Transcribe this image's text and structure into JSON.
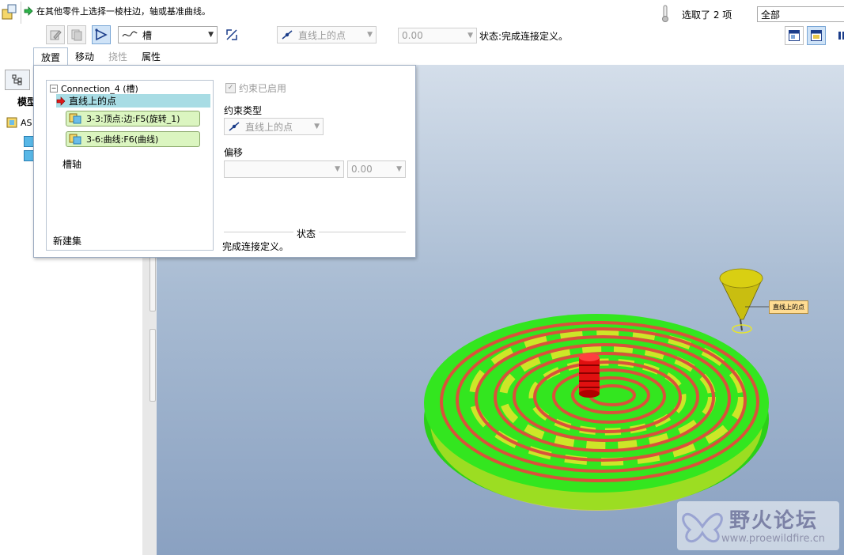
{
  "message": {
    "text": "在其他零件上选择一棱柱边，轴或基准曲线。"
  },
  "dashboard": {
    "connection_type": "槽",
    "constraint_type": "直线上的点",
    "offset_value": "0.00",
    "status_text": "状态:完成连接定义。",
    "tabs": [
      {
        "label": "放置",
        "state": "active"
      },
      {
        "label": "移动",
        "state": "normal"
      },
      {
        "label": "挠性",
        "state": "disabled"
      },
      {
        "label": "属性",
        "state": "normal"
      }
    ]
  },
  "selection": {
    "count_text": "选取了 2 项",
    "filter_value": "全部"
  },
  "navigator": {
    "title": "模型",
    "root_label": "AS"
  },
  "placement_panel": {
    "connection_name": "Connection_4 (槽)",
    "constraint_item": "直线上的点",
    "references": [
      "3-3:顶点:边:F5(旋转_1)",
      "3-6:曲线:F6(曲线)"
    ],
    "slot_axis": "槽轴",
    "new_set": "新建集",
    "constraint_enabled": "约束已启用",
    "constraint_type_label": "约束类型",
    "constraint_type_value": "直线上的点",
    "offset_label": "偏移",
    "offset_value": "0.00",
    "status_label": "状态",
    "status_message": "完成连接定义。"
  },
  "graphics": {
    "point_label": "直线上的点",
    "colors": {
      "disc_top": "#33e61f",
      "disc_side": "#2bcf18",
      "groove": "#d9523a",
      "yellow_fill": "#e8e62a",
      "pin": "#e01010",
      "cone": "#d9cf12"
    }
  },
  "watermark": {
    "title": "野火论坛",
    "url": "www.proewildfire.cn"
  }
}
